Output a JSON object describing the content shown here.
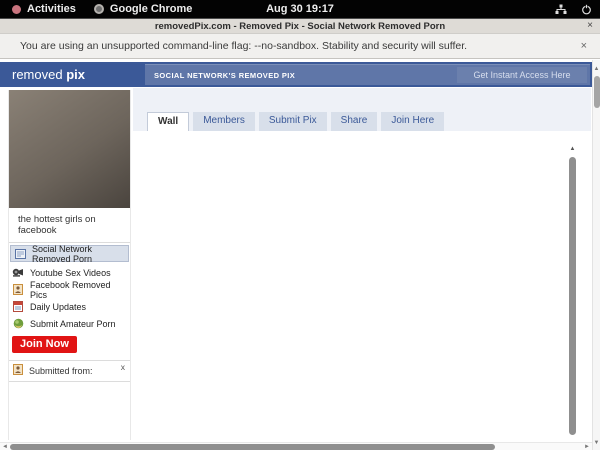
{
  "desktop_bar": {
    "activities_label": "Activities",
    "app_name": "Google Chrome",
    "clock": "Aug 30  19:17"
  },
  "window": {
    "title": "removedPix.com - Removed Pix - Social Network Removed Porn"
  },
  "warning_bar": {
    "message": "You are using an unsupported command-line flag: --no-sandbox. Stability and security will suffer."
  },
  "site_header": {
    "logo_regular": "removed ",
    "logo_bold": "pix",
    "banner_title": "SOCIAL NETWORK'S REMOVED PIX",
    "access_button": "Get Instant Access Here"
  },
  "sidebar": {
    "photo_caption": "the hottest girls on facebook",
    "menu": [
      {
        "label": "Social Network Removed Porn"
      },
      {
        "label": "Youtube Sex Videos"
      },
      {
        "label": "Facebook Removed Pics"
      },
      {
        "label": "Daily Updates"
      },
      {
        "label": "Submit Amateur Porn"
      }
    ],
    "join_button": "Join Now",
    "submitted_label": "Submitted from:",
    "submitted_close": "x"
  },
  "tabs": [
    {
      "label": "Wall"
    },
    {
      "label": "Members"
    },
    {
      "label": "Submit Pix"
    },
    {
      "label": "Share"
    },
    {
      "label": "Join Here"
    }
  ],
  "icons": {
    "close": "×",
    "arrow_up": "▲",
    "arrow_down": "▼",
    "arrow_left": "◄",
    "arrow_right": "►"
  },
  "colors": {
    "header_blue": "#3b5998",
    "banner_blue": "#5f76a8",
    "tab_inactive": "#d8dfea",
    "join_red": "#e11414"
  }
}
